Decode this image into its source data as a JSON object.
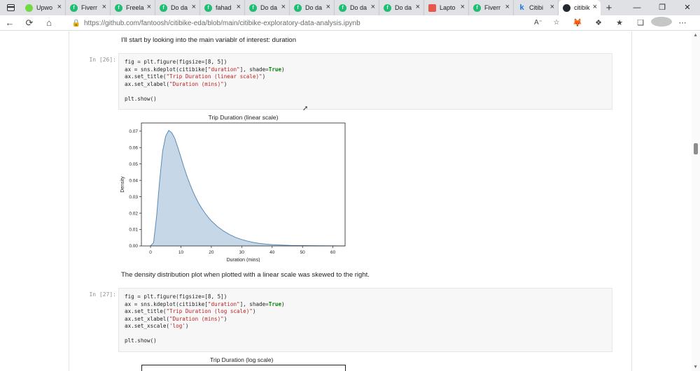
{
  "browser": {
    "tabs": [
      {
        "label": "Upwo",
        "icon": "upwork-icon"
      },
      {
        "label": "Fiverr",
        "icon": "fiverr-icon"
      },
      {
        "label": "Freela",
        "icon": "fiverr-icon"
      },
      {
        "label": "Do da",
        "icon": "fiverr-icon"
      },
      {
        "label": "fahad",
        "icon": "fiverr-icon"
      },
      {
        "label": "Do da",
        "icon": "fiverr-icon"
      },
      {
        "label": "Do da",
        "icon": "fiverr-icon"
      },
      {
        "label": "Do da",
        "icon": "fiverr-icon"
      },
      {
        "label": "Do da",
        "icon": "fiverr-icon"
      },
      {
        "label": "Lapto",
        "icon": "mail-icon"
      },
      {
        "label": "Fiverr",
        "icon": "fiverr-icon"
      },
      {
        "label": "Citibi",
        "icon": "kaggle-icon"
      },
      {
        "label": "citibik",
        "icon": "github-icon",
        "active": true
      }
    ],
    "url": "https://github.com/fantoosh/citibike-eda/blob/main/citibike-exploratory-data-analysis.ipynb"
  },
  "notebook": {
    "intro_text": "I'll start by looking into the main variablr of interest: duration",
    "cell1": {
      "prompt": "In [26]:",
      "lines": [
        [
          {
            "t": "fig = plt.figure(figsize=[8, 5])"
          }
        ],
        [
          {
            "t": "ax = sns.kdeplot(citibike["
          },
          {
            "t": "\"duration\"",
            "c": "str"
          },
          {
            "t": "], shade="
          },
          {
            "t": "True",
            "c": "kw"
          },
          {
            "t": ")"
          }
        ],
        [
          {
            "t": "ax.set_title("
          },
          {
            "t": "\"Trip Duration (linear scale)\"",
            "c": "str"
          },
          {
            "t": ")"
          }
        ],
        [
          {
            "t": "ax.set_xlabel("
          },
          {
            "t": "\"Duration (mins)\"",
            "c": "str"
          },
          {
            "t": ")"
          }
        ],
        [
          {
            "t": ""
          }
        ],
        [
          {
            "t": "plt.show()"
          }
        ]
      ]
    },
    "between_text": "The density distribution plot when plotted with a linear scale was skewed to the right.",
    "cell2": {
      "prompt": "In [27]:",
      "lines": [
        [
          {
            "t": "fig = plt.figure(figsize=[8, 5])"
          }
        ],
        [
          {
            "t": "ax = sns.kdeplot(citibike["
          },
          {
            "t": "\"duration\"",
            "c": "str"
          },
          {
            "t": "], shade="
          },
          {
            "t": "True",
            "c": "kw"
          },
          {
            "t": ")"
          }
        ],
        [
          {
            "t": "ax.set_title("
          },
          {
            "t": "\"Trip Duration (log scale)\"",
            "c": "str"
          },
          {
            "t": ")"
          }
        ],
        [
          {
            "t": "ax.set_xlabel("
          },
          {
            "t": "\"Duration (mins)\"",
            "c": "str"
          },
          {
            "t": ")"
          }
        ],
        [
          {
            "t": "ax.set_xscale("
          },
          {
            "t": "'log'",
            "c": "str"
          },
          {
            "t": ")"
          }
        ],
        [
          {
            "t": ""
          }
        ],
        [
          {
            "t": "plt.show()"
          }
        ]
      ]
    },
    "chart2_title": "Trip Duration (log scale)"
  },
  "chart_data": {
    "type": "area",
    "title": "Trip Duration (linear scale)",
    "xlabel": "Duration (mins)",
    "ylabel": "Density",
    "xlim": [
      -3,
      64
    ],
    "ylim": [
      0,
      0.075
    ],
    "xticks": [
      0,
      10,
      20,
      30,
      40,
      50,
      60
    ],
    "yticks": [
      0.0,
      0.01,
      0.02,
      0.03,
      0.04,
      0.05,
      0.06,
      0.07
    ],
    "ytick_labels": [
      "0.00",
      "0.01",
      "0.02",
      "0.03",
      "0.04",
      "0.05",
      "0.06",
      "0.07"
    ],
    "grid": false,
    "colors": {
      "fill": "#c6d8e8",
      "line": "#5b89b5"
    },
    "series": [
      {
        "x": [
          0,
          1,
          2,
          3,
          4,
          5,
          6,
          7,
          8,
          9,
          10,
          11,
          12,
          13,
          14,
          15,
          16,
          17,
          18,
          19,
          20,
          22,
          24,
          26,
          28,
          30,
          32,
          34,
          36,
          38,
          40,
          43,
          46,
          50,
          55,
          60,
          64
        ],
        "y": [
          0.0,
          0.002,
          0.018,
          0.04,
          0.058,
          0.067,
          0.0705,
          0.069,
          0.0655,
          0.06,
          0.054,
          0.048,
          0.0425,
          0.0375,
          0.033,
          0.029,
          0.0255,
          0.0225,
          0.0198,
          0.0174,
          0.0153,
          0.0118,
          0.0091,
          0.0069,
          0.0052,
          0.0039,
          0.0029,
          0.0021,
          0.0015,
          0.0011,
          0.0008,
          0.0005,
          0.0003,
          0.0002,
          0.0001,
          5e-05,
          0.0
        ]
      }
    ]
  }
}
